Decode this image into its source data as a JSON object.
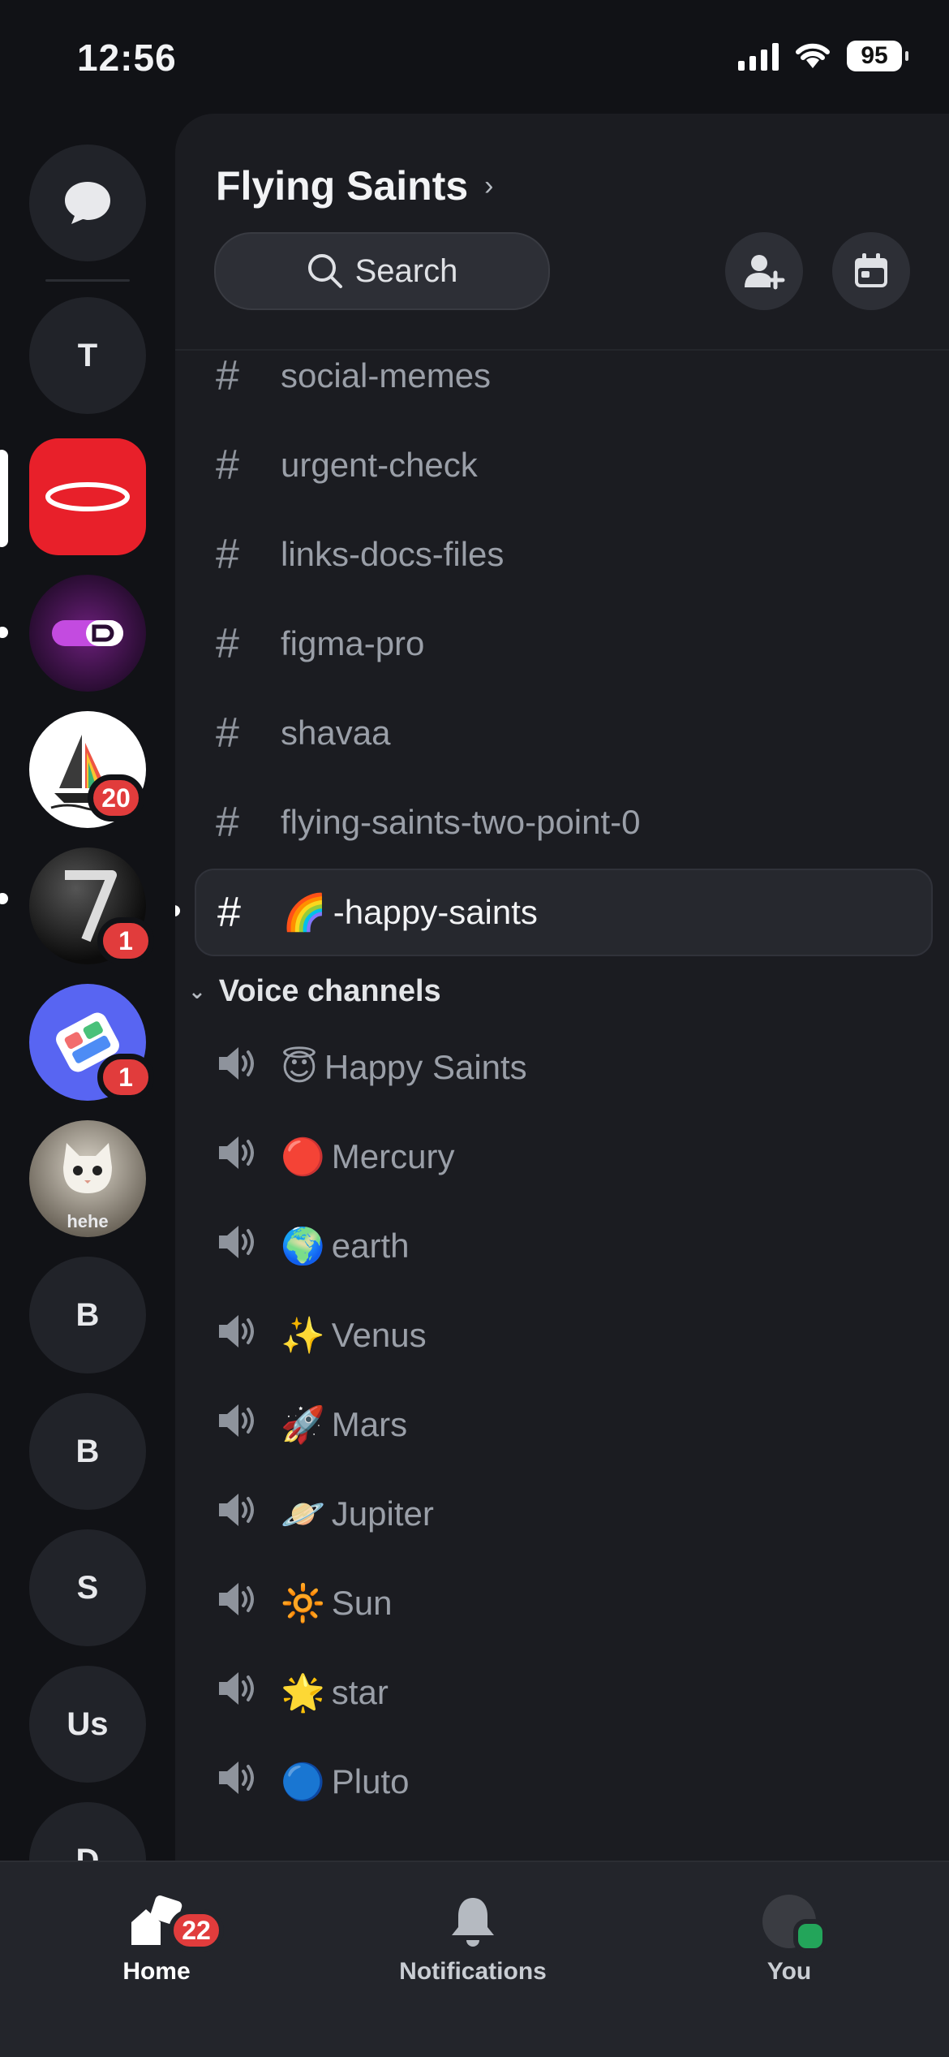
{
  "status_bar": {
    "time": "12:56",
    "battery": "95"
  },
  "rail": {
    "servers": [
      {
        "label": "T"
      },
      {
        "label": "B"
      },
      {
        "label": "B"
      },
      {
        "label": "S"
      },
      {
        "label": "Us"
      },
      {
        "label": "D"
      }
    ],
    "badges": {
      "sailboat": "20",
      "seven": "1",
      "app": "1"
    },
    "cat_caption": "hehe"
  },
  "server": {
    "name": "Flying Saints",
    "search_label": "Search"
  },
  "channels": [
    {
      "name": "social-memes"
    },
    {
      "name": "urgent-check"
    },
    {
      "name": "links-docs-files"
    },
    {
      "name": "figma-pro"
    },
    {
      "name": "shavaa"
    },
    {
      "name": "flying-saints-two-point-0"
    },
    {
      "name": "-happy-saints",
      "emoji": "🌈",
      "active": true
    }
  ],
  "voice_category": "Voice channels",
  "voice_channels": [
    {
      "emoji": "😇",
      "name": "Happy Saints"
    },
    {
      "emoji": "🔴",
      "name": "Mercury"
    },
    {
      "emoji": "🌍",
      "name": "earth"
    },
    {
      "emoji": "✨",
      "name": "Venus"
    },
    {
      "emoji": "🚀",
      "name": "Mars"
    },
    {
      "emoji": "🪐",
      "name": "Jupiter"
    },
    {
      "emoji": "🔆",
      "name": "Sun"
    },
    {
      "emoji": "🌟",
      "name": "star"
    },
    {
      "emoji": "🔵",
      "name": "Pluto"
    }
  ],
  "tabs": {
    "home": {
      "label": "Home",
      "badge": "22"
    },
    "notifications": {
      "label": "Notifications"
    },
    "you": {
      "label": "You"
    }
  },
  "colors": {
    "accent_red": "#e13c3c",
    "online_green": "#23a55a",
    "brand_blurple": "#5865f2"
  }
}
